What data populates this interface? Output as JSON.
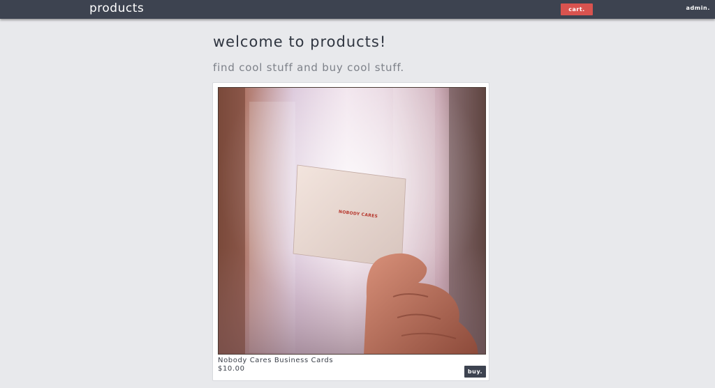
{
  "navbar": {
    "brand": "products",
    "cart_label": "cart.",
    "admin_label": "admin.",
    "bg_color": "#3d4350",
    "cart_color": "#d9534f"
  },
  "main": {
    "title": "welcome to products!",
    "subtitle": "find cool stuff and buy cool stuff."
  },
  "products": [
    {
      "name": "Nobody Cares Business Cards",
      "price": "$10.00",
      "buy_label": "buy.",
      "image_card_text": "NOBODY CARES"
    }
  ]
}
